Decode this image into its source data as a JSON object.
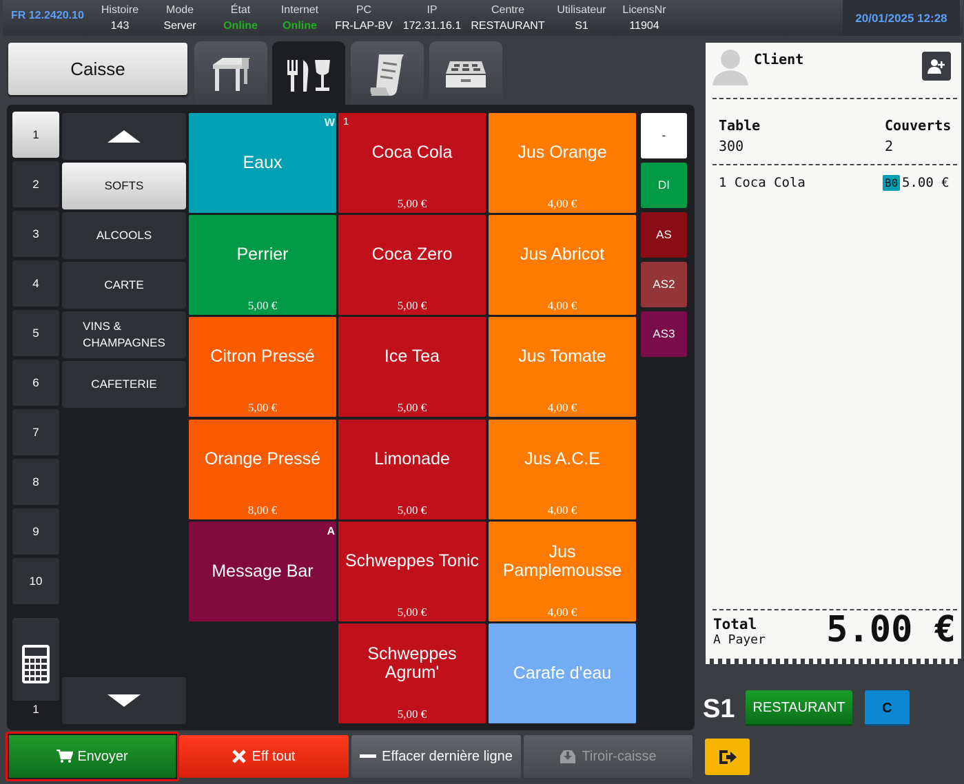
{
  "status": {
    "version": "FR 12.2420.10",
    "items": [
      {
        "label": "Histoire",
        "value": "143"
      },
      {
        "label": "Mode",
        "value": "Server"
      },
      {
        "label": "État",
        "value": "Online"
      },
      {
        "label": "Internet",
        "value": "Online"
      },
      {
        "label": "PC",
        "value": "FR-LAP-BV"
      },
      {
        "label": "IP",
        "value": "172.31.16.1"
      },
      {
        "label": "Centre",
        "value": "RESTAURANT"
      },
      {
        "label": "Utilisateur",
        "value": "S1"
      },
      {
        "label": "LicensNr",
        "value": "11904"
      }
    ],
    "datetime": "20/01/2025 12:28",
    "online_color": "#1fb01f"
  },
  "nav": {
    "caisse_label": "Caisse",
    "tabs": [
      "table-icon",
      "cutlery-glass-icon",
      "receipt-icon",
      "cash-drawer-icon"
    ],
    "active_tab": "cutlery-glass-icon"
  },
  "numbers": [
    "1",
    "2",
    "3",
    "4",
    "5",
    "6",
    "7",
    "8",
    "9",
    "10"
  ],
  "selected_number": "1",
  "calculator_value": "1",
  "categories": [
    "SOFTS",
    "ALCOOLS",
    "CARTE",
    "VINS &\nCHAMPAGNES",
    "CAFETERIE"
  ],
  "selected_category": "SOFTS",
  "products": [
    {
      "name": "Eaux",
      "price": "",
      "color": "#00a0b4",
      "tag": "W"
    },
    {
      "name": "Coca Cola",
      "price": "5,00 €",
      "color": "#c0101c",
      "tag": "1"
    },
    {
      "name": "Jus Orange",
      "price": "4,00 €",
      "color": "#ff7a00",
      "tag": ""
    },
    {
      "name": "Perrier",
      "price": "5,00 €",
      "color": "#039a46",
      "tag": ""
    },
    {
      "name": "Coca Zero",
      "price": "5,00 €",
      "color": "#c0101c",
      "tag": ""
    },
    {
      "name": "Jus Abricot",
      "price": "4,00 €",
      "color": "#ff7a00",
      "tag": ""
    },
    {
      "name": "Citron Pressé",
      "price": "5,00 €",
      "color": "#fa5a00",
      "tag": ""
    },
    {
      "name": "Ice Tea",
      "price": "5,00 €",
      "color": "#c0101c",
      "tag": ""
    },
    {
      "name": "Jus Tomate",
      "price": "4,00 €",
      "color": "#ff7a00",
      "tag": ""
    },
    {
      "name": "Orange Pressé",
      "price": "8,00 €",
      "color": "#fa5a00",
      "tag": ""
    },
    {
      "name": "Limonade",
      "price": "5,00 €",
      "color": "#c0101c",
      "tag": ""
    },
    {
      "name": "Jus A.C.E",
      "price": "4,00 €",
      "color": "#ff7a00",
      "tag": ""
    },
    {
      "name": "Message Bar",
      "price": "",
      "color": "#820a3f",
      "tag": "A"
    },
    {
      "name": "Schweppes Tonic",
      "price": "5,00 €",
      "color": "#c0101c",
      "tag": ""
    },
    {
      "name": "Jus Pamplemousse",
      "price": "4,00 €",
      "color": "#ff7a00",
      "tag": ""
    },
    {
      "name": "Schweppes Agrum'",
      "price": "5,00 €",
      "color": "#c0101c",
      "tag": ""
    },
    {
      "name": "Carafe d'eau",
      "price": "",
      "color": "#74abf5",
      "tag": ""
    }
  ],
  "modifiers": [
    {
      "label": "-",
      "color": "#ffffff",
      "text": "#111111"
    },
    {
      "label": "DI",
      "color": "#039a46",
      "text": "#ffffff"
    },
    {
      "label": "AS",
      "color": "#8a0c14",
      "text": "#ffffff"
    },
    {
      "label": "AS2",
      "color": "#943638",
      "text": "#ffffff"
    },
    {
      "label": "AS3",
      "color": "#7a0c4a",
      "text": "#ffffff"
    }
  ],
  "ticket": {
    "client_label": "Client",
    "table_label": "Table",
    "table_value": "300",
    "covers_label": "Couverts",
    "covers_value": "2",
    "lines": [
      {
        "qty": "1",
        "name": "Coca Cola",
        "badge": "B0",
        "amount": "5.00 €"
      }
    ],
    "total_label": "Total",
    "to_pay_label": "A Payer",
    "total_value": "5.00 €"
  },
  "user_badge": "S1",
  "restaurant_label": "RESTAURANT",
  "c_label": "C",
  "buttons": {
    "send": "Envoyer",
    "clear_all": "Eff tout",
    "delete_last": "Effacer dernière ligne",
    "drawer": "Tiroir-caisse"
  }
}
